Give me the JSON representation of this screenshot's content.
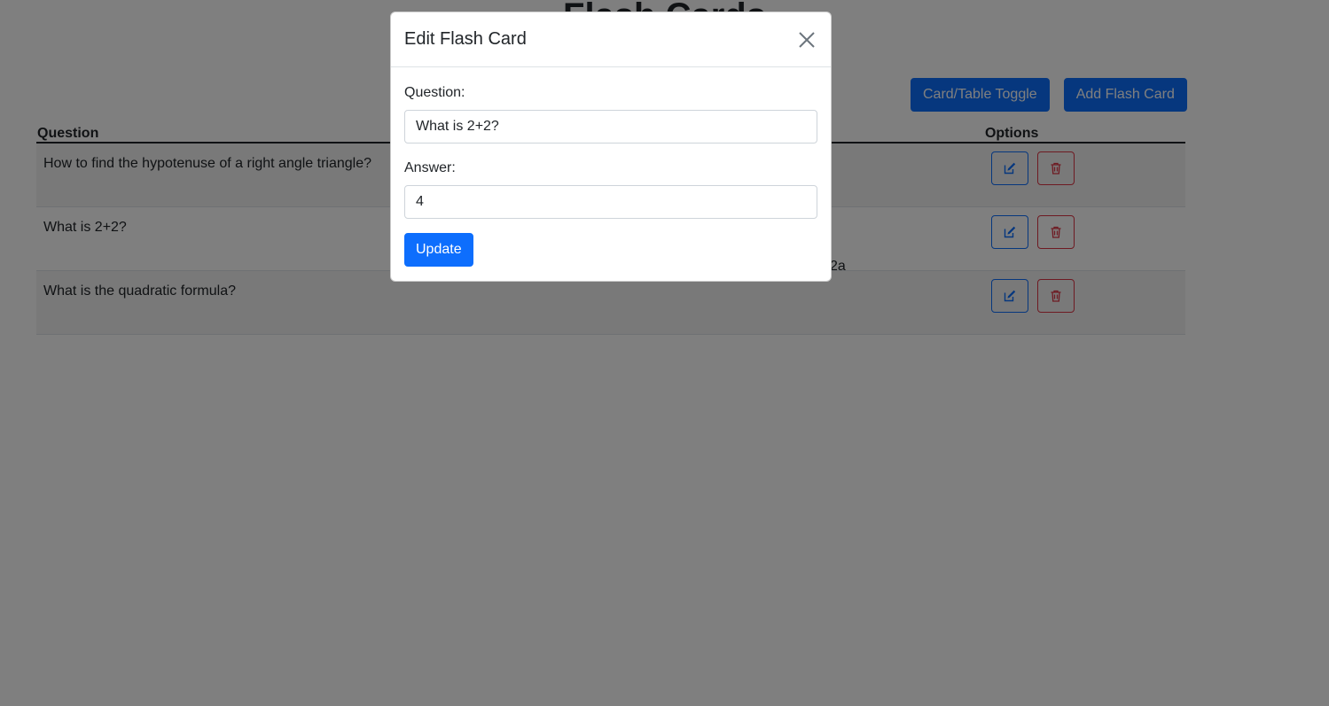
{
  "page": {
    "title": "Flash Cards"
  },
  "toolbar": {
    "toggle_label": "Card/Table Toggle",
    "add_label": "Add Flash Card"
  },
  "table": {
    "headers": {
      "question": "Question",
      "options": "Options"
    },
    "rows": [
      {
        "question": "How to find the hypotenuse of a right angle triangle?",
        "answer_visible": ""
      },
      {
        "question": "What is 2+2?",
        "answer_visible": ""
      },
      {
        "question": "What is the quadratic formula?",
        "answer_visible": "2a"
      }
    ],
    "edit_icon": "edit-icon",
    "delete_icon": "trash-icon"
  },
  "modal": {
    "title": "Edit Flash Card",
    "question_label": "Question:",
    "question_value": "What is 2+2?",
    "answer_label": "Answer:",
    "answer_value": "4",
    "update_label": "Update",
    "close_icon": "close-icon"
  },
  "colors": {
    "primary": "#0d6efd",
    "danger": "#dc3545",
    "backdrop": "rgba(0,0,0,0.5)"
  }
}
